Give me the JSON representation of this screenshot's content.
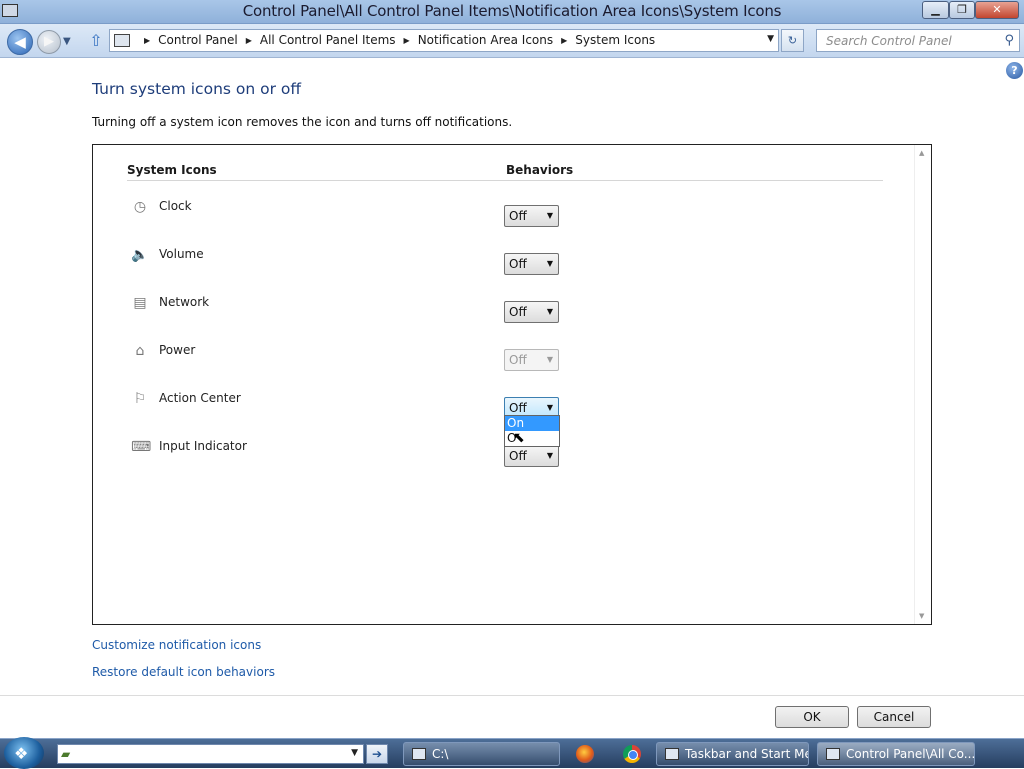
{
  "window": {
    "title": "Control Panel\\All Control Panel Items\\Notification Area Icons\\System Icons",
    "min_label": "▁",
    "max_label": "❐",
    "close_label": "✕"
  },
  "nav": {
    "back_label": "◀",
    "forward_label": "▶",
    "breadcrumbs": [
      "Control Panel",
      "All Control Panel Items",
      "Notification Area Icons",
      "System Icons"
    ],
    "search_placeholder": "Search Control Panel"
  },
  "page": {
    "heading": "Turn system icons on or off",
    "description": "Turning off a system icon removes the icon and turns off notifications.",
    "col_system_icons": "System Icons",
    "col_behaviors": "Behaviors",
    "rows": [
      {
        "label": "Clock",
        "icon": "clock-icon",
        "value": "Off"
      },
      {
        "label": "Volume",
        "icon": "volume-icon",
        "value": "Off"
      },
      {
        "label": "Network",
        "icon": "network-icon",
        "value": "Off"
      },
      {
        "label": "Power",
        "icon": "power-icon",
        "value": "Off"
      },
      {
        "label": "Action Center",
        "icon": "action-center-flag-icon",
        "value": "Off"
      },
      {
        "label": "Input Indicator",
        "icon": "keyboard-icon",
        "value": "Off"
      }
    ],
    "dropdown_options": [
      "On",
      "Off"
    ],
    "dropdown_selected": "On",
    "dropdown_visible_second": "O",
    "link_customize": "Customize notification icons",
    "link_restore": "Restore default icon behaviors",
    "ok_label": "OK",
    "cancel_label": "Cancel"
  },
  "taskbar": {
    "tasks": [
      "C:\\",
      "Taskbar and Start Me...",
      "Control Panel\\All Co..."
    ]
  }
}
